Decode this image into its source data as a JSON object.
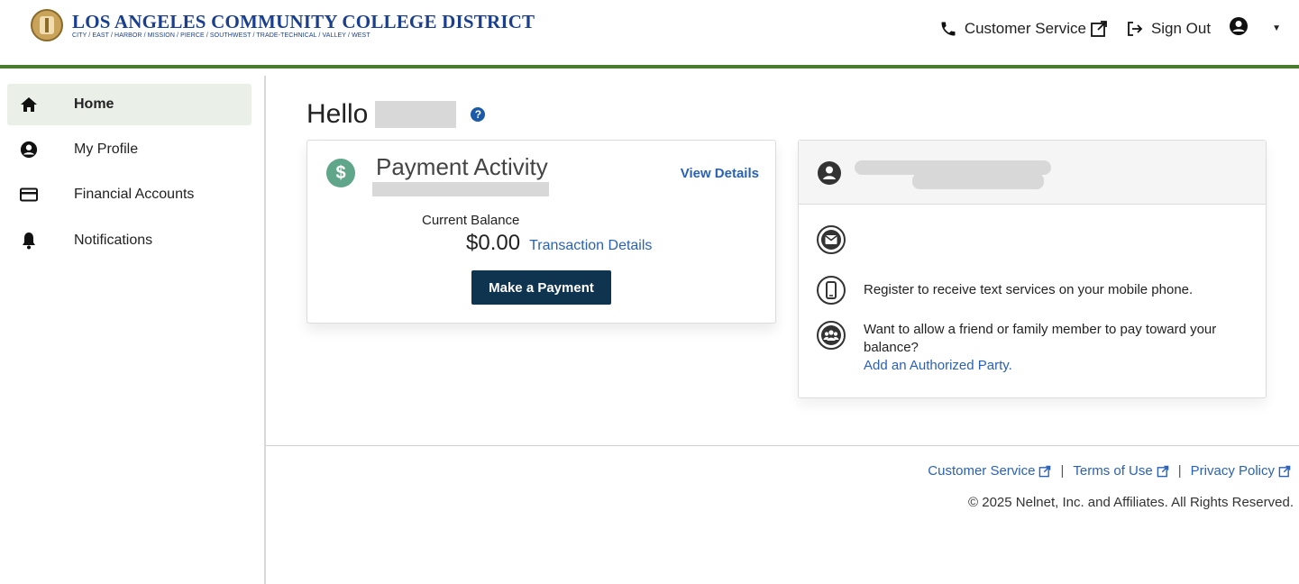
{
  "header": {
    "logo_title": "LOS ANGELES COMMUNITY COLLEGE DISTRICT",
    "logo_subtitle": "CITY / EAST / HARBOR / MISSION / PIERCE / SOUTHWEST / TRADE-TECHNICAL / VALLEY / WEST",
    "customer_service": "Customer Service",
    "sign_out": "Sign Out",
    "accent_color": "#4a7a2e"
  },
  "sidebar": {
    "items": [
      {
        "label": "Home",
        "icon": "home-icon",
        "active": true
      },
      {
        "label": "My Profile",
        "icon": "user-circle-icon",
        "active": false
      },
      {
        "label": "Financial Accounts",
        "icon": "credit-card-icon",
        "active": false
      },
      {
        "label": "Notifications",
        "icon": "bell-icon",
        "active": false
      }
    ]
  },
  "main": {
    "greeting": "Hello",
    "payment_card": {
      "title": "Payment Activity",
      "view_details": "View Details",
      "current_balance_label": "Current Balance",
      "balance": "$0.00",
      "transaction_details": "Transaction Details",
      "make_payment": "Make a Payment"
    },
    "profile_card": {
      "register_text": "Register to receive text services on your mobile phone.",
      "authorized_text": "Want to allow a friend or family member to pay toward your balance?",
      "authorized_link": "Add an Authorized Party."
    }
  },
  "footer": {
    "customer_service": "Customer Service",
    "terms": "Terms of Use",
    "privacy": "Privacy Policy",
    "separator": "|",
    "copyright": "© 2025 Nelnet, Inc. and Affiliates. All Rights Reserved."
  }
}
